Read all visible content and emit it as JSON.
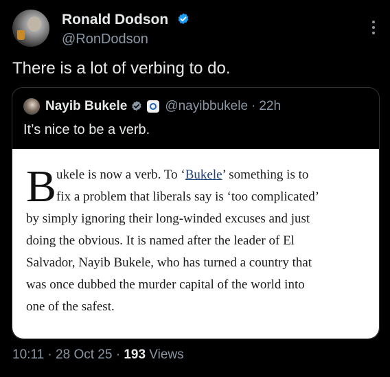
{
  "author": {
    "display_name": "Ronald Dodson",
    "handle": "@RonDodson"
  },
  "tweet": {
    "text": "There is a lot of verbing to do."
  },
  "quoted": {
    "display_name": "Nayib Bukele",
    "handle": "@nayibbukele",
    "separator": "·",
    "time": "22h",
    "text": "It’s nice to be a verb.",
    "image_article": {
      "dropcap": "B",
      "line1_a": "ukele is now a verb. To ‘",
      "line1_link": "Bukele",
      "line1_b": "’ something is to",
      "line2": "fix a problem that liberals say is ‘too complicated’",
      "line3": "by simply ignoring their long-winded excuses and just",
      "line4": "doing the obvious. It is named after the leader of El",
      "line5": "Salvador, Nayib Bukele, who has turned a country that",
      "line6": "was once dubbed the murder capital of the world into",
      "line7": "one of the safest."
    }
  },
  "meta": {
    "time": "10:11",
    "sep1": "·",
    "date": "28 Oct 25",
    "sep2": "·",
    "views_count": "193",
    "views_label": "Views"
  },
  "colors": {
    "background": "#000000",
    "text_primary": "#e7e9ea",
    "text_secondary": "#8b98a5",
    "verified_blue": "#1d9bf0",
    "link": "#1f3f74"
  },
  "icons": {
    "verified": "verified-badge-icon",
    "more": "more-options-icon",
    "affiliate": "affiliate-badge-icon"
  }
}
